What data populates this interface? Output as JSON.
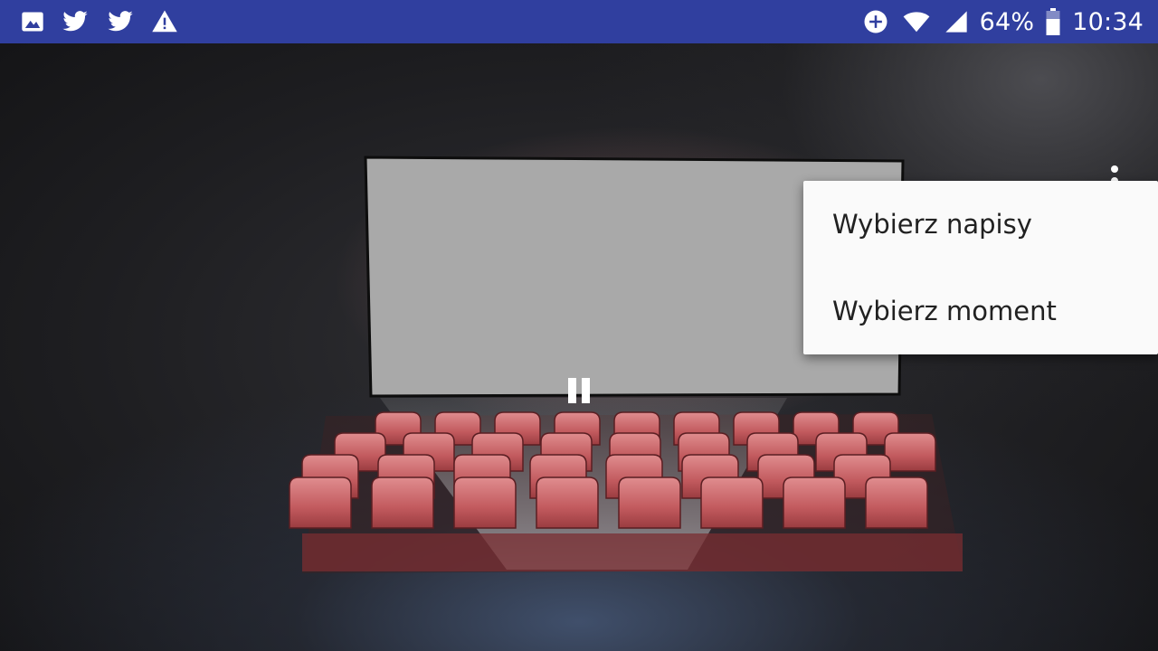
{
  "status_bar": {
    "left_icons": [
      "image-icon",
      "twitter-icon",
      "twitter-icon",
      "warning-icon"
    ],
    "right_icons": [
      "data-saver-icon",
      "wifi-icon",
      "cellular-signal-icon",
      "battery-icon"
    ],
    "battery_percent": "64%",
    "time": "10:34",
    "background": "#303f9f"
  },
  "player": {
    "state": "paused",
    "pause_icon": "pause-icon",
    "overflow_icon": "more-vert-icon"
  },
  "menu": {
    "items": [
      {
        "label": "Wybierz napisy"
      },
      {
        "label": "Wybierz moment"
      }
    ]
  },
  "colors": {
    "seat": "#c85a5e",
    "screen": "#a9a9a9",
    "menu_bg": "#fafafa",
    "menu_text": "#212121"
  }
}
